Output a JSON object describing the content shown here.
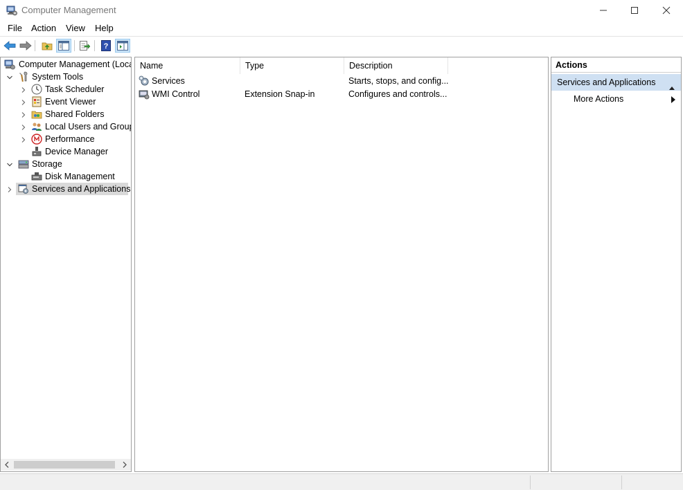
{
  "window": {
    "title": "Computer Management",
    "app_icon": "computer-management-icon"
  },
  "menu": {
    "file": "File",
    "action": "Action",
    "view": "View",
    "help": "Help"
  },
  "toolbar": {
    "icons": [
      "back-arrow-icon",
      "forward-arrow-icon",
      "up-folder-icon",
      "show-hide-tree-icon",
      "export-list-icon",
      "help-icon",
      "show-hide-action-pane-icon"
    ]
  },
  "tree": {
    "root": "Computer Management (Local",
    "system_tools": "System Tools",
    "task_scheduler": "Task Scheduler",
    "event_viewer": "Event Viewer",
    "shared_folders": "Shared Folders",
    "local_users": "Local Users and Groups",
    "performance": "Performance",
    "device_manager": "Device Manager",
    "storage": "Storage",
    "disk_management": "Disk Management",
    "services_apps": "Services and Applications"
  },
  "list": {
    "columns": [
      "Name",
      "Type",
      "Description"
    ],
    "rows": [
      {
        "name": "Services",
        "type": "",
        "description": "Starts, stops, and config..."
      },
      {
        "name": "WMI Control",
        "type": "Extension Snap-in",
        "description": "Configures and controls..."
      }
    ]
  },
  "actions": {
    "title": "Actions",
    "section": "Services and Applications",
    "more": "More Actions"
  },
  "colors": {
    "selection_bg": "#d9d9d9",
    "actions_section_bg": "#cfe0f2",
    "toolbar_active_bg": "#cce4f7"
  }
}
